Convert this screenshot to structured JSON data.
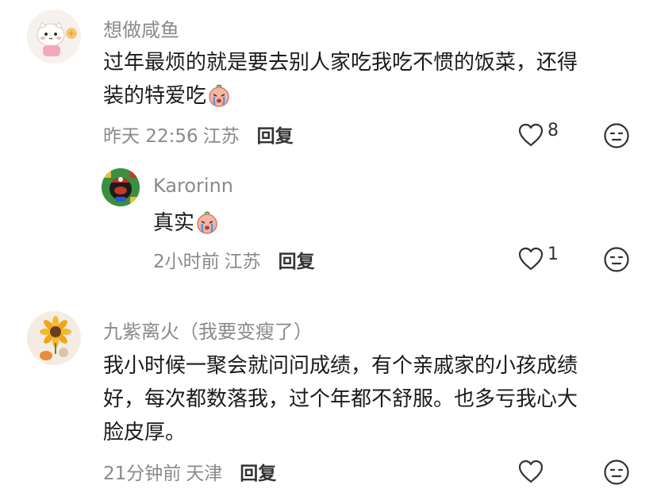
{
  "comments": [
    {
      "username": "想做咸鱼",
      "text_lines": [
        "过年最烦的就是要去别人家吃我吃不惯的饭菜，还得",
        "装的特爱吃"
      ],
      "time": "昨天 22:56",
      "location": "江苏",
      "reply_label": "回复",
      "likes": "8",
      "avatar_icon": "cat-avatar-icon",
      "emoji_icon": "crying-peach-emoji"
    },
    {
      "username": "Karorinn",
      "text_lines": [
        "真实"
      ],
      "time": "2小时前",
      "location": "江苏",
      "reply_label": "回复",
      "likes": "1",
      "avatar_icon": "mario-avatar-icon",
      "emoji_icon": "crying-peach-emoji"
    },
    {
      "username": "九紫离火（我要变瘦了）",
      "text_lines": [
        "我小时候一聚会就问问成绩，有个亲戚家的小孩成绩",
        "好，每次都数落我，过个年都不舒服。也多亏我心大",
        "脸皮厚。"
      ],
      "time": "21分钟前",
      "location": "天津",
      "reply_label": "回复",
      "likes": "",
      "avatar_icon": "sunflower-avatar-icon"
    }
  ]
}
